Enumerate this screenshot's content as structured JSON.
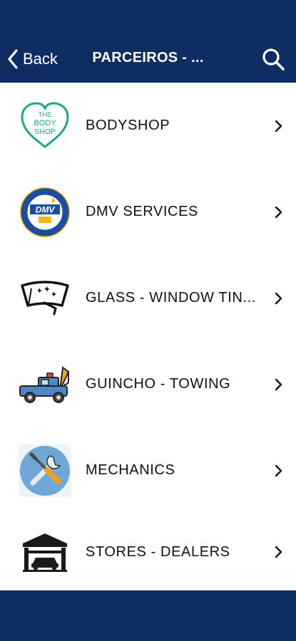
{
  "header": {
    "back_label": "Back",
    "title": "PARCEIROS - ...",
    "bg_color": "#0e2e63"
  },
  "items": [
    {
      "label": "BODYSHOP",
      "icon": "the-body-shop-logo",
      "logo_text": [
        "THE",
        "BODY",
        "SHOP"
      ]
    },
    {
      "label": "DMV SERVICES",
      "icon": "dmv-seal-logo",
      "logo_text": [
        "DMV"
      ]
    },
    {
      "label": "GLASS - WINDOW TIN...",
      "icon": "windshield-icon"
    },
    {
      "label": "GUINCHO - TOWING",
      "icon": "tow-truck-icon"
    },
    {
      "label": "MECHANICS",
      "icon": "wrench-screwdriver-icon"
    },
    {
      "label": "STORES - DEALERS",
      "icon": "garage-icon"
    }
  ]
}
